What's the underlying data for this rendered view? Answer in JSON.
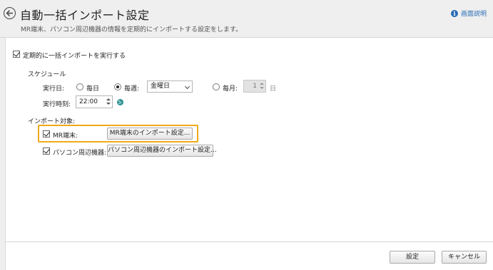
{
  "header": {
    "title": "自動一括インポート設定",
    "subtitle": "MR端末、パソコン周辺機器の情報を定期的にインポートする設定をします。",
    "help_label": "画面説明"
  },
  "main": {
    "enable_label": "定期的に一括インポートを実行する",
    "enable_checked": true,
    "schedule": {
      "heading": "スケジュール",
      "run_day_label": "実行日:",
      "daily_label": "毎日",
      "weekly_label": "毎週:",
      "weekday_value": "金曜日",
      "monthly_label": "毎月:",
      "month_day_value": "1",
      "day_unit": "日",
      "run_time_label": "実行時刻:",
      "run_time_value": "22:00"
    },
    "targets": {
      "heading": "インポート対象:",
      "mr_label": "MR端末:",
      "mr_button": "MR端末のインポート設定...",
      "pc_label": "パソコン周辺機器:",
      "pc_button": "パソコン周辺機器のインポート設定..."
    }
  },
  "footer": {
    "save_label": "設定",
    "cancel_label": "キャンセル"
  },
  "colors": {
    "highlight": "#f0a91b",
    "link": "#2a6db5"
  }
}
